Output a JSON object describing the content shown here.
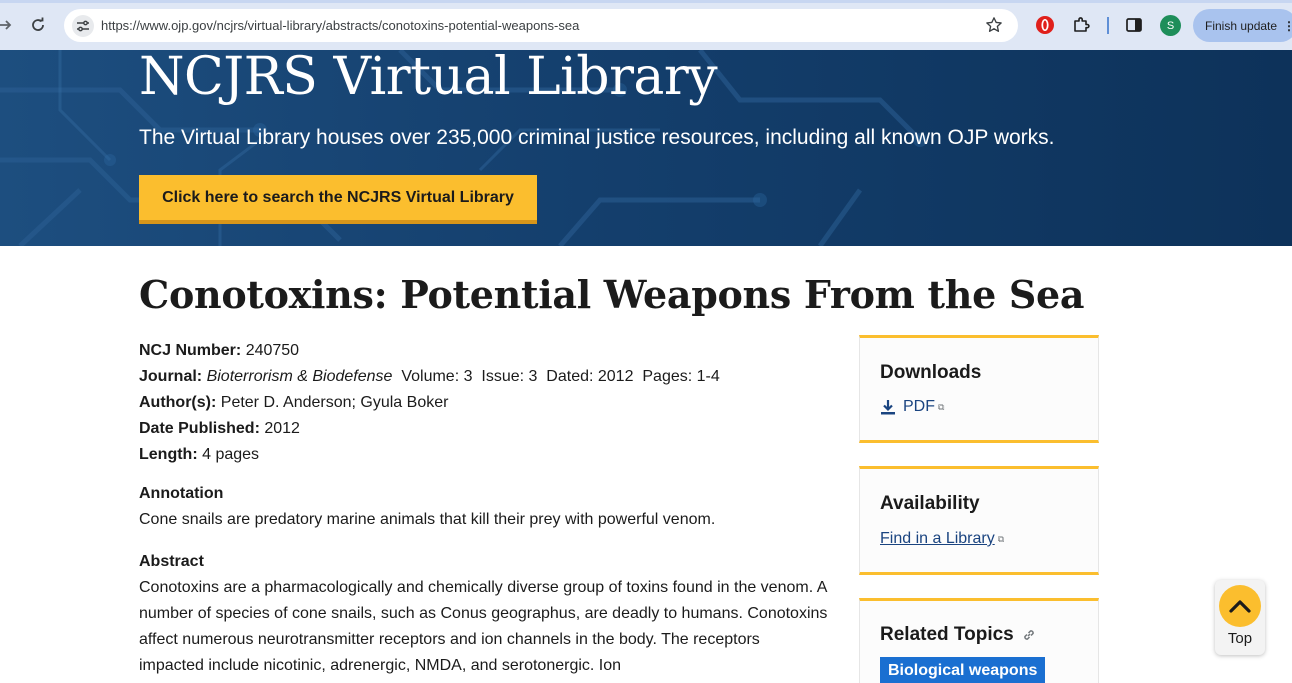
{
  "browser": {
    "url": "https://www.ojp.gov/ncjrs/virtual-library/abstracts/conotoxins-potential-weapons-sea",
    "profile_initial": "S",
    "update_label": "Finish update"
  },
  "hero": {
    "title": "NCJRS Virtual Library",
    "subtitle": "The Virtual Library houses over 235,000 criminal justice resources, including all known OJP works.",
    "search_button": "Click here to search the NCJRS Virtual Library"
  },
  "article": {
    "title": "Conotoxins: Potential Weapons From the Sea",
    "ncj_label": "NCJ Number:",
    "ncj_value": "240750",
    "journal_label": "Journal:",
    "journal_name": "Bioterrorism & Biodefense",
    "journal_details": "Volume: 3  Issue: 3  Dated: 2012  Pages: 1-4",
    "authors_label": "Author(s):",
    "authors_value": "Peter D. Anderson; Gyula Boker",
    "date_label": "Date Published:",
    "date_value": "2012",
    "length_label": "Length:",
    "length_value": "4 pages",
    "annotation_label": "Annotation",
    "annotation_text": "Cone snails are predatory marine animals that kill their prey with powerful venom.",
    "abstract_label": "Abstract",
    "abstract_text": "Conotoxins are a pharmacologically and chemically diverse group of toxins found in the venom. A number of species of cone snails, such as Conus geographus, are deadly to humans. Conotoxins affect numerous neurotransmitter receptors and ion channels in the body. The receptors impacted include nicotinic, adrenergic, NMDA, and serotonergic. Ion"
  },
  "sidebar": {
    "downloads_title": "Downloads",
    "pdf_label": "PDF",
    "availability_title": "Availability",
    "find_library_label": "Find in a Library",
    "related_title": "Related Topics",
    "topic_tag": "Biological weapons"
  },
  "back_to_top": {
    "label": "Top"
  },
  "colors": {
    "hero_bg": "#0f3761",
    "accent_gold": "#fbbe2e",
    "link_blue": "#1a4480",
    "tag_blue": "#1a6fd1"
  }
}
